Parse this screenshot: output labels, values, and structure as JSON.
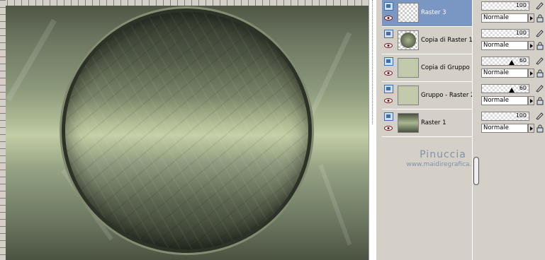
{
  "layers": [
    {
      "name": "Raster 3",
      "thumb": "transparent",
      "selected": true
    },
    {
      "name": "Copia di Raster 1",
      "thumb": "globe",
      "selected": false
    },
    {
      "name": "Copia di Gruppo",
      "thumb": "group",
      "selected": false
    },
    {
      "name": "Gruppo - Raster 2",
      "thumb": "group",
      "selected": false
    },
    {
      "name": "Raster 1",
      "thumb": "raster",
      "selected": false
    }
  ],
  "properties": [
    {
      "opacity": "100",
      "blend": "Normale"
    },
    {
      "opacity": "100",
      "blend": "Normale"
    },
    {
      "opacity": "60",
      "blend": "Normale"
    },
    {
      "opacity": "60",
      "blend": "Normale"
    },
    {
      "opacity": "100",
      "blend": "Normale"
    }
  ],
  "watermark": {
    "line1": "Pinuccia",
    "line2": "www.maidiregrafica.eu"
  },
  "colors": {
    "selected_layer": "#7a96c2",
    "panel_bg": "#d4d0c8",
    "watermark": "#7f93a8"
  }
}
